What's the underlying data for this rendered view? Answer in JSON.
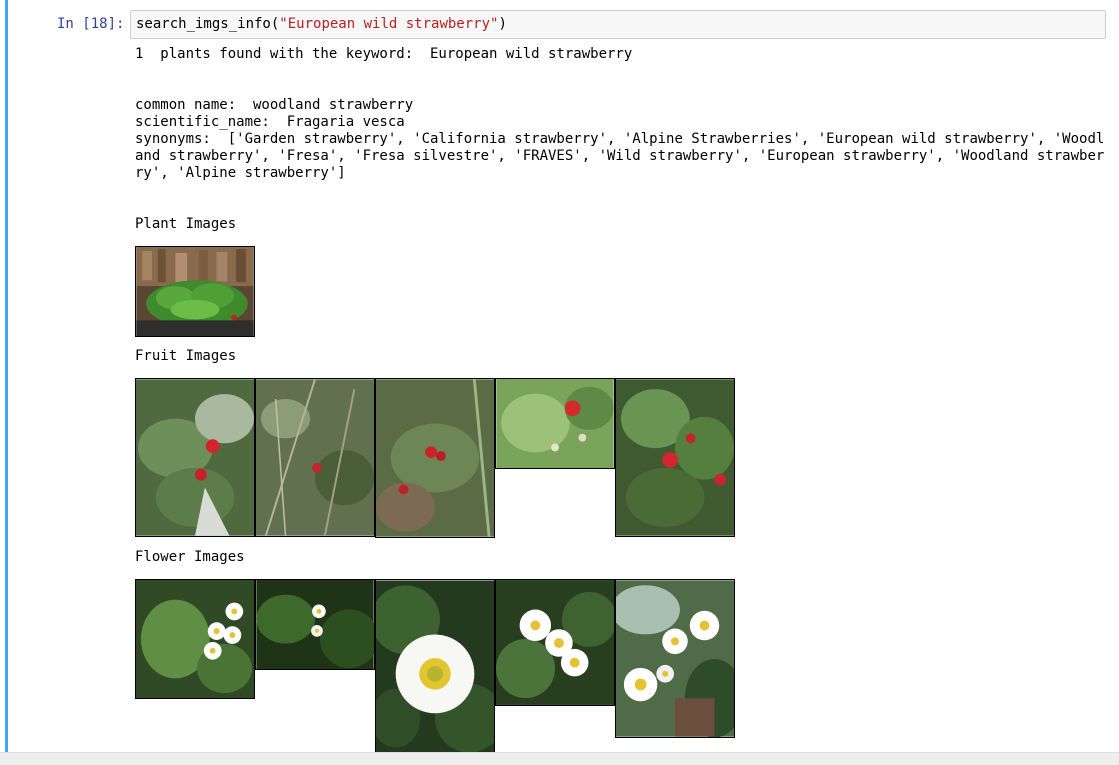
{
  "cell": {
    "prompt": "In [18]:",
    "code_func": "search_imgs_info(",
    "code_arg": "\"European wild strawberry\"",
    "code_close": ")"
  },
  "output": {
    "found_line": "1  plants found with the keyword:  European wild strawberry",
    "common_name": "common name:  woodland strawberry",
    "scientific_name": "scientific_name:  Fragaria vesca",
    "synonyms": "synonyms:  ['Garden strawberry', 'California strawberry', 'Alpine Strawberries', 'European wild strawberry', 'Woodland strawberry', 'Fresa', 'Fresa silvestre', 'FRAVES', 'Wild strawberry', 'European strawberry', 'Woodland strawberry', 'Alpine strawberry']",
    "plant_images_label": "Plant Images",
    "fruit_images_label": "Fruit Images",
    "flower_images_label": "Flower Images"
  },
  "colors": {
    "cell_bar": "#42a5f5",
    "prompt": "#303f9f",
    "string": "#ba2121"
  }
}
